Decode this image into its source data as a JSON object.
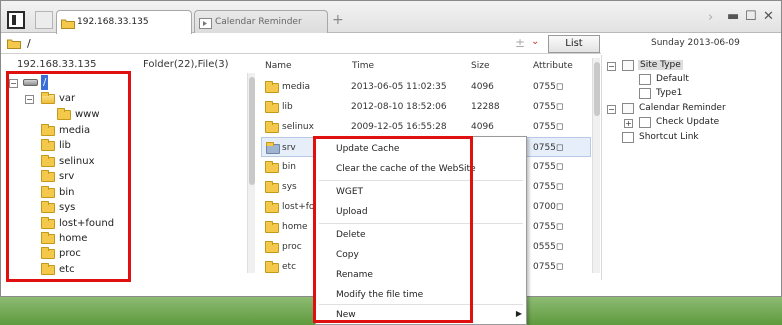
{
  "tabs": [
    {
      "label": "192.168.33.135",
      "active": true
    },
    {
      "label": "Calendar Reminder",
      "active": false
    }
  ],
  "address": {
    "path": "/",
    "list_button": "List",
    "date": "Sunday 2013-06-09"
  },
  "left_pane": {
    "host": "192.168.33.135",
    "summary": "Folder(22),File(3)"
  },
  "tree": [
    {
      "label": "/",
      "selected": true
    },
    {
      "label": "var"
    },
    {
      "label": "www"
    },
    {
      "label": "media"
    },
    {
      "label": "lib"
    },
    {
      "label": "selinux"
    },
    {
      "label": "srv"
    },
    {
      "label": "bin"
    },
    {
      "label": "sys"
    },
    {
      "label": "lost+found"
    },
    {
      "label": "home"
    },
    {
      "label": "proc"
    },
    {
      "label": "etc"
    }
  ],
  "file_columns": {
    "name": "Name",
    "time": "Time",
    "size": "Size",
    "attribute": "Attribute"
  },
  "files": [
    {
      "name": "media",
      "time": "2013-06-05 11:02:35",
      "size": "4096",
      "attr": "0755◻"
    },
    {
      "name": "lib",
      "time": "2012-08-10 18:52:06",
      "size": "12288",
      "attr": "0755◻"
    },
    {
      "name": "selinux",
      "time": "2009-12-05 16:55:28",
      "size": "4096",
      "attr": "0755◻"
    },
    {
      "name": "srv",
      "time": "",
      "size": "",
      "attr": "0755◻"
    },
    {
      "name": "bin",
      "time": "",
      "size": "",
      "attr": "0755◻"
    },
    {
      "name": "sys",
      "time": "",
      "size": "",
      "attr": "0755◻"
    },
    {
      "name": "lost+foun",
      "time": "",
      "size": "",
      "attr": "0700◻"
    },
    {
      "name": "home",
      "time": "",
      "size": "",
      "attr": "0755◻"
    },
    {
      "name": "proc",
      "time": "",
      "size": "",
      "attr": "0555◻"
    },
    {
      "name": "etc",
      "time": "",
      "size": "",
      "attr": "0755◻"
    }
  ],
  "right_pane": {
    "site_type": "Site Type",
    "default": "Default",
    "type1": "Type1",
    "calendar": "Calendar Reminder",
    "check_update": "Check Update",
    "shortcut": "Shortcut Link"
  },
  "context_menu": [
    "Update Cache",
    "Clear the cache of the WebSite",
    "WGET",
    "Upload",
    "Delete",
    "Copy",
    "Rename",
    "Modify the file time",
    "New"
  ],
  "colors": {
    "highlight": "#e01010",
    "selection": "#3a6fd8"
  }
}
